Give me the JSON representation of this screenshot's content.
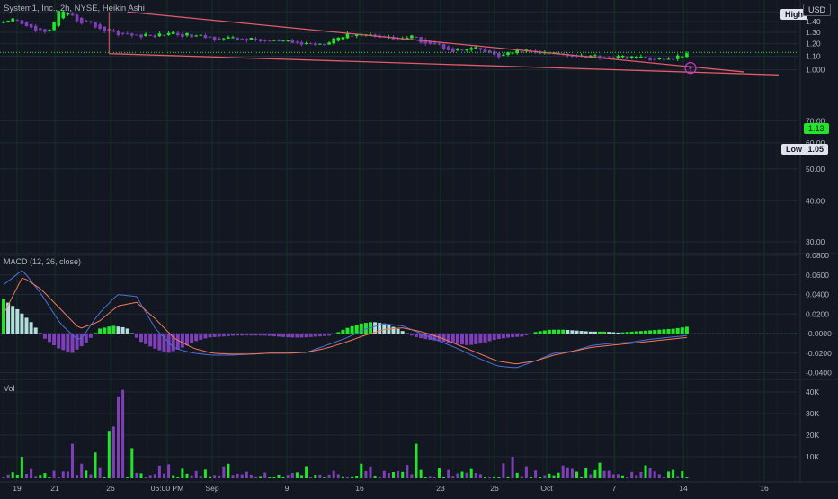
{
  "header": {
    "title": "System1, Inc., 2h, NYSE, Heikin Ashi",
    "high_label": "High",
    "currency": "USD",
    "low_label": "Low",
    "low_value": "1.05",
    "last_value": "1.13"
  },
  "colors": {
    "background": "#131722",
    "grid": "#1f2937",
    "vgrid_green": "#0f3324",
    "up": "#22e52a",
    "down": "#7e3fb8",
    "hist_up_strong": "#22e52a",
    "hist_up_weak": "#b2dfdb",
    "hist_down": "#7e3fb8",
    "macd_line": "#4d6fd8",
    "signal_line": "#f2785a",
    "trendline": "#e35a6a",
    "text": "#b2b5be",
    "dotted_price": "#22e52a"
  },
  "icons": {
    "flash_marker": "lightning-icon"
  },
  "chart_data": [
    {
      "type": "candlestick",
      "title": "System1, Inc., 2h, NYSE, Heikin Ashi",
      "scale": "log",
      "ylim": [
        0.28,
        1.55
      ],
      "price_ticks": [
        "1.50",
        "1.40",
        "1.30",
        "1.20",
        "1.10",
        "1.000",
        "70.00",
        "60.00",
        "50.00",
        "40.00",
        "30.00"
      ],
      "x_labels": [
        "19",
        "21",
        "26",
        "06:00 PM",
        "Sep",
        "9",
        "16",
        "23",
        "26",
        "Oct",
        "7",
        "14",
        "16"
      ],
      "high_marker": "High",
      "low_marker": {
        "label": "Low",
        "value": "1.05"
      },
      "last_price": "1.13",
      "wedge_upper": [
        {
          "bar": 0,
          "price": 1.5
        },
        {
          "bar": 130,
          "price": 1.02
        }
      ],
      "wedge_lower": [
        {
          "bar": 0,
          "price": 1.12
        },
        {
          "bar": 146,
          "price": 0.98
        }
      ],
      "key_prices": [
        1.38,
        1.42,
        1.35,
        1.33,
        1.28,
        1.5,
        1.46,
        1.4,
        1.38,
        1.32,
        1.3,
        1.28,
        1.27,
        1.27,
        1.27,
        1.3,
        1.28,
        1.27,
        1.26,
        1.25,
        1.25,
        1.24,
        1.24,
        1.23,
        1.22,
        1.22,
        1.21,
        1.2,
        1.2,
        1.2,
        1.25,
        1.27,
        1.29,
        1.28,
        1.27,
        1.25,
        1.24,
        1.26,
        1.22,
        1.2,
        1.17,
        1.14,
        1.15,
        1.16,
        1.12,
        1.1,
        1.12,
        1.15,
        1.13,
        1.12,
        1.12,
        1.11,
        1.11,
        1.1,
        1.1,
        1.09,
        1.09,
        1.1,
        1.08,
        1.08,
        1.07,
        1.09,
        1.12
      ]
    },
    {
      "type": "macd",
      "title": "MACD (12, 26, close)",
      "ylim": [
        -0.045,
        0.08
      ],
      "ticks": [
        "0.0800",
        "0.0600",
        "0.0400",
        "0.0200",
        "-0.0000",
        "-0.0200",
        "-0.0400"
      ],
      "histogram_key": [
        0.035,
        0.025,
        0.012,
        -0.005,
        -0.015,
        -0.02,
        -0.01,
        0.005,
        0.008,
        0.006,
        -0.008,
        -0.015,
        -0.02,
        -0.015,
        -0.008,
        -0.004,
        -0.003,
        -0.002,
        -0.002,
        -0.002,
        -0.003,
        -0.004,
        -0.004,
        -0.003,
        -0.002,
        0.005,
        0.01,
        0.012,
        0.01,
        0.004,
        -0.003,
        -0.006,
        -0.008,
        -0.01,
        -0.012,
        -0.01,
        -0.006,
        -0.004,
        -0.003,
        0.002,
        0.004,
        0.004,
        0.003,
        0.002,
        0.002,
        0.001,
        0.002,
        0.003,
        0.004,
        0.005,
        0.007
      ],
      "macd_key": [
        0.05,
        0.065,
        0.04,
        0.01,
        -0.008,
        0.02,
        0.04,
        0.038,
        0.005,
        -0.015,
        -0.02,
        -0.022,
        -0.022,
        -0.021,
        -0.02,
        -0.02,
        -0.019,
        -0.012,
        -0.005,
        0.004,
        0.01,
        0.008,
        0.0,
        -0.008,
        -0.016,
        -0.025,
        -0.033,
        -0.035,
        -0.028,
        -0.02,
        -0.018,
        -0.012,
        -0.01,
        -0.009,
        -0.006,
        -0.004,
        -0.002
      ],
      "signal_key": [
        0.02,
        0.058,
        0.045,
        0.025,
        0.005,
        0.012,
        0.028,
        0.032,
        0.015,
        -0.005,
        -0.015,
        -0.02,
        -0.021,
        -0.021,
        -0.02,
        -0.02,
        -0.019,
        -0.015,
        -0.009,
        -0.002,
        0.004,
        0.006,
        0.002,
        -0.004,
        -0.012,
        -0.02,
        -0.028,
        -0.031,
        -0.028,
        -0.022,
        -0.018,
        -0.014,
        -0.012,
        -0.01,
        -0.008,
        -0.006,
        -0.004
      ]
    },
    {
      "type": "bar",
      "title": "Vol",
      "ylim": [
        0,
        45000
      ],
      "ticks": [
        "40K",
        "30K",
        "20K",
        "10K"
      ],
      "spikes": [
        {
          "bar": 24,
          "value": 24000,
          "color": "down"
        },
        {
          "bar": 25,
          "value": 38000,
          "color": "down"
        },
        {
          "bar": 26,
          "value": 41000,
          "color": "down"
        },
        {
          "bar": 23,
          "value": 22000,
          "color": "up"
        },
        {
          "bar": 28,
          "value": 14000,
          "color": "up"
        },
        {
          "bar": 15,
          "value": 16000,
          "color": "down"
        },
        {
          "bar": 20,
          "value": 12000,
          "color": "up"
        },
        {
          "bar": 90,
          "value": 16000,
          "color": "up"
        },
        {
          "bar": 111,
          "value": 10000,
          "color": "down"
        },
        {
          "bar": 169,
          "value": 10000,
          "color": "up"
        },
        {
          "bar": 4,
          "value": 10000,
          "color": "up"
        }
      ]
    }
  ]
}
